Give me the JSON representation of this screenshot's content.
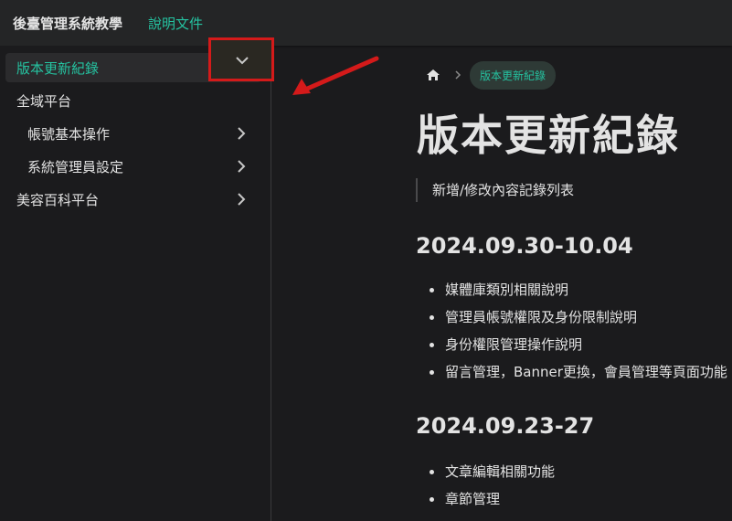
{
  "header": {
    "brand": "後臺管理系統教學",
    "docs_link": "說明文件"
  },
  "sidebar": {
    "items": [
      {
        "label": "版本更新紀錄",
        "active": true
      },
      {
        "label": "全域平台",
        "expanded": true
      },
      {
        "label": "帳號基本操作",
        "level": 2
      },
      {
        "label": "系統管理員設定",
        "level": 2
      },
      {
        "label": "美容百科平台"
      }
    ]
  },
  "breadcrumb": {
    "current": "版本更新紀錄"
  },
  "page": {
    "title": "版本更新紀錄",
    "description": "新增/修改內容記錄列表",
    "sections": [
      {
        "heading": "2024.09.30-10.04",
        "items": [
          "媒體庫類別相關說明",
          "管理員帳號權限及身份限制說明",
          "身份權限管理操作說明",
          "留言管理，Banner更換，會員管理等頁面功能"
        ]
      },
      {
        "heading": "2024.09.23-27",
        "items": [
          "文章編輯相關功能",
          "章節管理"
        ]
      }
    ]
  },
  "annotation": {
    "highlight_color": "#d41a1a"
  },
  "colors": {
    "accent": "#25c2a0",
    "background": "#1b1b1d",
    "navbar": "#242526"
  }
}
